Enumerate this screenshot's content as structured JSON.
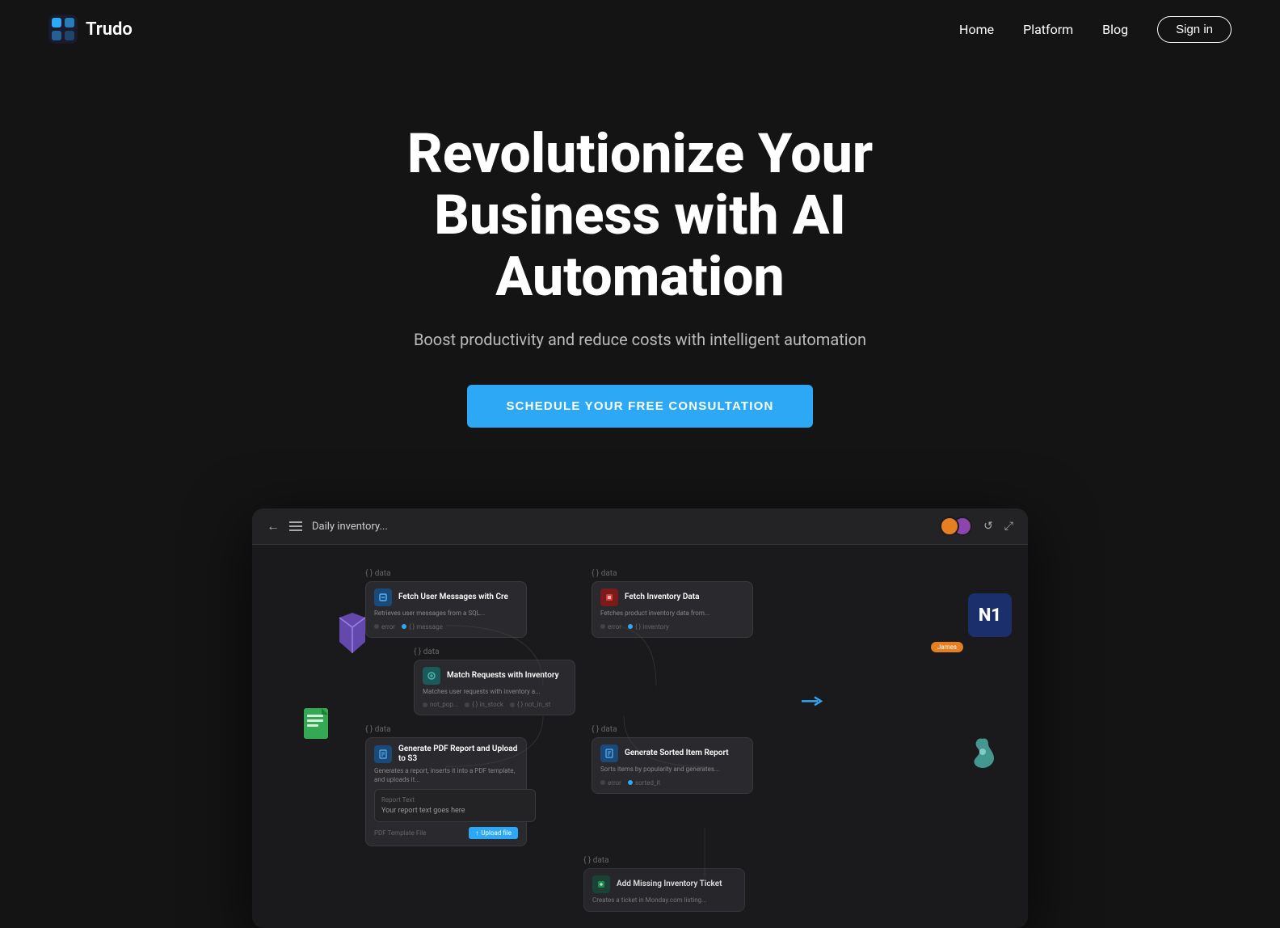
{
  "brand": {
    "name": "Trudo",
    "logo_alt": "Trudo logo"
  },
  "navbar": {
    "links": [
      {
        "label": "Home",
        "id": "home"
      },
      {
        "label": "Platform",
        "id": "platform"
      },
      {
        "label": "Blog",
        "id": "blog"
      }
    ],
    "signin_label": "Sign in"
  },
  "hero": {
    "title": "Revolutionize Your Business with AI Automation",
    "subtitle": "Boost productivity and reduce costs with intelligent automation",
    "cta_label": "SCHEDULE YOUR FREE CONSULTATION"
  },
  "dashboard": {
    "title": "Daily inventory...",
    "nodes": [
      {
        "id": "fetch-user-messages",
        "title": "Fetch User Messages with Cre",
        "desc": "Retrieves user messages from a SQL...",
        "icon_color": "blue",
        "row": 0,
        "col": 0
      },
      {
        "id": "fetch-inventory-data",
        "title": "Fetch Inventory Data",
        "desc": "Fetches product inventory data from...",
        "icon_color": "red",
        "row": 0,
        "col": 1
      },
      {
        "id": "match-requests",
        "title": "Match Requests with Inventory",
        "desc": "Matches user requests with inventory a...",
        "icon_color": "teal",
        "row": 1,
        "col": 0
      },
      {
        "id": "generate-pdf",
        "title": "Generate PDF Report and Upload to S3",
        "desc": "Generates a report, inserts it into a PDF template, and uploads it...",
        "icon_color": "blue",
        "row": 2,
        "col": 0
      },
      {
        "id": "generate-sorted",
        "title": "Generate Sorted Item Report",
        "desc": "Sorts items by popularity and generates...",
        "icon_color": "blue",
        "row": 2,
        "col": 1
      },
      {
        "id": "add-missing-ticket",
        "title": "Add Missing Inventory Ticket",
        "desc": "Creates a ticket in Monday.com listing...",
        "icon_color": "blue",
        "row": 3,
        "col": 1
      }
    ],
    "text_input": {
      "label": "Report Text",
      "placeholder": "Your report text goes here"
    },
    "upload": {
      "label": "PDF Template File",
      "btn_label": "Upload file"
    }
  },
  "colors": {
    "bg": "#141414",
    "accent": "#2da8f5",
    "node_bg": "#2a2a2e",
    "topbar_bg": "#232325"
  }
}
